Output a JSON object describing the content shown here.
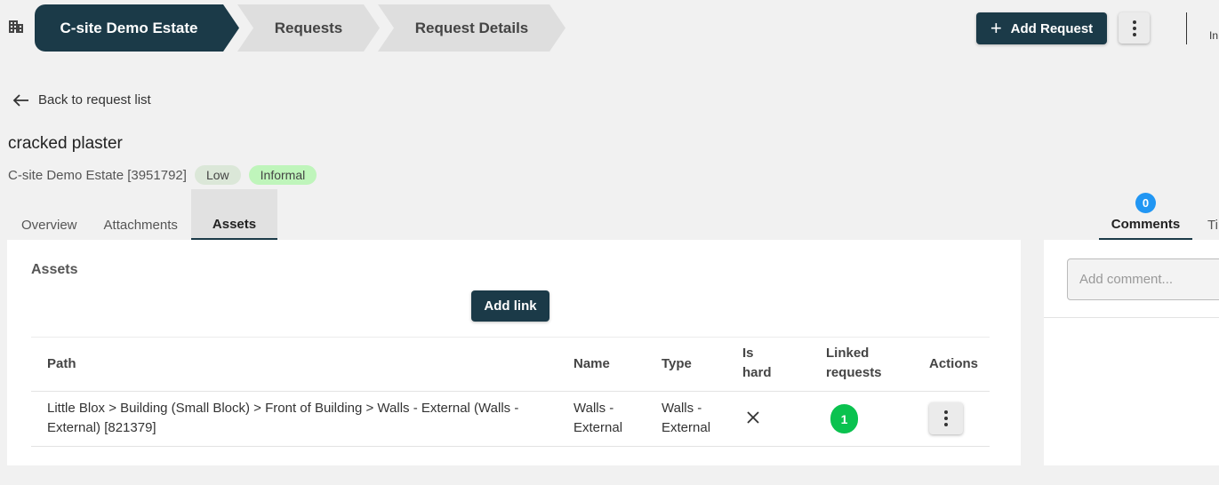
{
  "header": {
    "breadcrumbs": [
      "C-site Demo Estate",
      "Requests",
      "Request Details"
    ],
    "add_request_label": "Add Request",
    "cut_text": "In"
  },
  "back_link": "Back to request list",
  "request": {
    "title": "cracked plaster",
    "estate": "C-site Demo Estate [3951792]",
    "priority": "Low",
    "type": "Informal"
  },
  "tabs": [
    "Overview",
    "Attachments",
    "Assets"
  ],
  "active_tab": "Assets",
  "assets": {
    "title": "Assets",
    "add_link_label": "Add link",
    "columns": {
      "path": "Path",
      "name": "Name",
      "type": "Type",
      "is_hard_1": "Is",
      "is_hard_2": "hard",
      "linked_1": "Linked",
      "linked_2": "requests",
      "actions": "Actions"
    },
    "rows": [
      {
        "path_1": "Little Blox > Building (Small Block) > Front of Building > Walls - External (Walls -",
        "path_2": "External) [821379]",
        "name_1": "Walls -",
        "name_2": "External",
        "type_1": "Walls -",
        "type_2": "External",
        "is_hard": false,
        "linked_requests": "1"
      }
    ]
  },
  "side": {
    "comments_count": "0",
    "comments_tab": "Comments",
    "second_tab": "Ti",
    "comment_placeholder": "Add comment..."
  },
  "colors": {
    "primary": "#1b3a48",
    "badge_blue": "#2196f3",
    "badge_green": "#0ac24f",
    "chip_low": "#dbe7d8",
    "chip_informal": "#bff5bb"
  },
  "icons": [
    "building-icon",
    "plus-icon",
    "more-vert-icon",
    "arrow-left-icon",
    "close-icon"
  ]
}
